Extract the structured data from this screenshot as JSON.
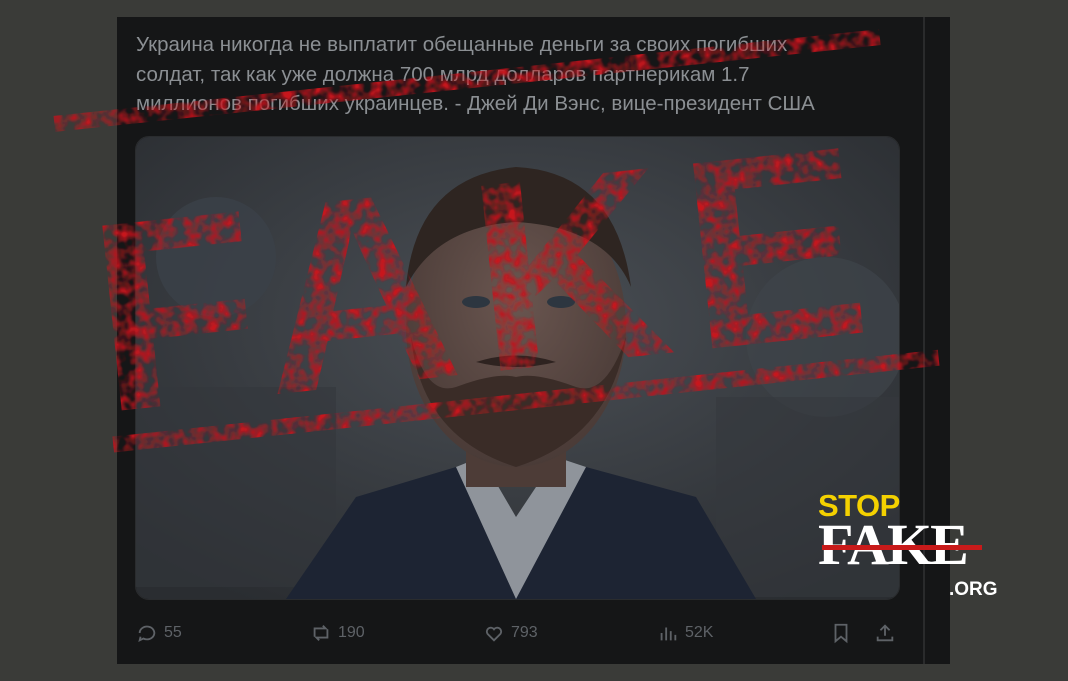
{
  "post": {
    "text": "Украина никогда не выплатит обещанные деньги за своих погибших\nсолдат, так как уже должна 700 млрд долларов партнерикам 1.7\nмиллионов погибших украинцев. - Джей Ди Вэнс, вице-президент США"
  },
  "actions": {
    "replies": "55",
    "reposts": "190",
    "likes": "793",
    "views": "52K"
  },
  "stamp": {
    "text": "FAKE",
    "color": "#c8141c"
  },
  "watermark": {
    "stop": "STOP",
    "fake": "FAKE",
    "org": ".ORG",
    "stop_color": "#f4d100",
    "bar_color": "#c81a1a"
  },
  "colors": {
    "page_bg": "#3a3b38",
    "post_bg": "#151617",
    "text": "#8b8f93",
    "icon": "#5e6267"
  }
}
